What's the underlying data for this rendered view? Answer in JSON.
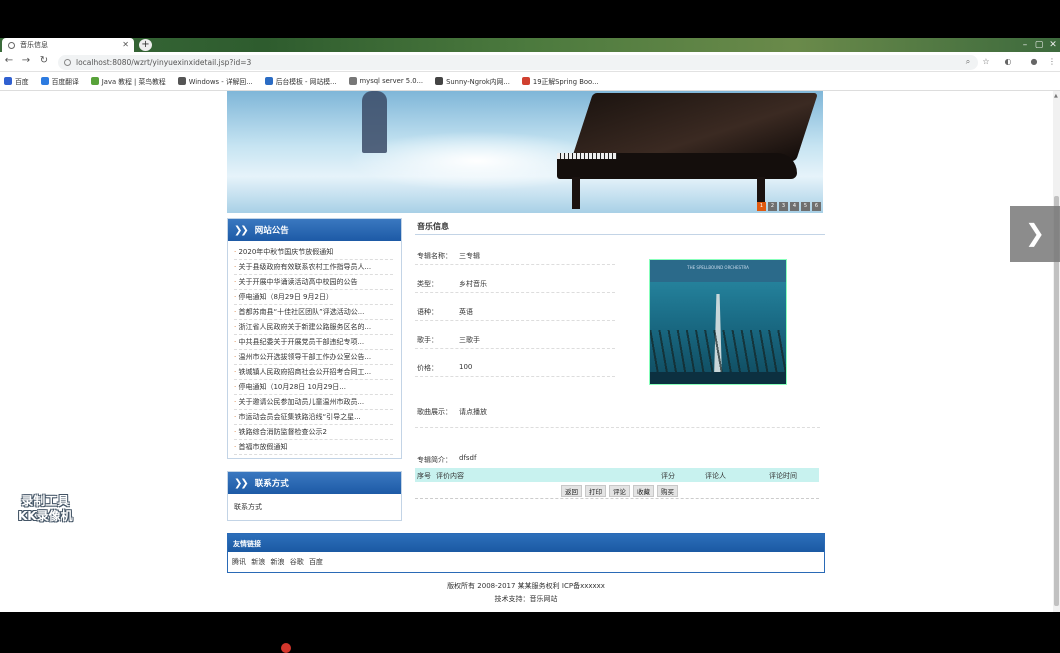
{
  "browser": {
    "tab_title": "音乐信息",
    "url": "localhost:8080/wzrt/yinyuexinxidetail.jsp?id=3",
    "bookmarks": [
      {
        "label": "百度",
        "color": "#3060d0"
      },
      {
        "label": "百度翻译",
        "color": "#2d7be0"
      },
      {
        "label": "Java 教程 | 菜鸟教程",
        "color": "#58a23a"
      },
      {
        "label": "Windows - 详解回...",
        "color": "#555555"
      },
      {
        "label": "后台模板 - 网站模...",
        "color": "#2b6cc4"
      },
      {
        "label": "mysql server 5.0...",
        "color": "#777777"
      },
      {
        "label": "Sunny-Ngrok内网...",
        "color": "#444444"
      },
      {
        "label": "19正解Spring Boo...",
        "color": "#d04030"
      }
    ]
  },
  "banner": {
    "pager": [
      "1",
      "2",
      "3",
      "4",
      "5",
      "6"
    ],
    "active_index": 0
  },
  "notices": {
    "title": "网站公告",
    "items": [
      "2020年中秋节国庆节放假通知",
      "关于县级政府有效联系农村工作指导员人...",
      "关于开展中华诵读活动高中校园的公告",
      "停电通知（8月29日 9月2日）",
      "首都苏南县“十佳社区团队”评选活动公...",
      "浙江省人民政府关于新建公路服务区名的...",
      "中共县纪委关于开展党员干部违纪专项...",
      "温州市公开选拔领导干部工作办公室公告...",
      "铁城镇人民政府招商社会公开招考合同工...",
      "停电通知（10月28日 10月29日...",
      "关于邀请公民参加动员儿童温州市政员...",
      "市运动会员会征集铁路沿线“引导之星...",
      "铁路综合消防监督检查公示2",
      "首福市放假通知"
    ]
  },
  "contact": {
    "title": "联系方式",
    "text": "联系方式"
  },
  "music": {
    "title": "音乐信息",
    "fields": [
      {
        "label": "专辑名称：",
        "value": "三专辑"
      },
      {
        "label": "类型：",
        "value": "乡村音乐"
      },
      {
        "label": "语种：",
        "value": "英语"
      },
      {
        "label": "歌手：",
        "value": "三歌手"
      },
      {
        "label": "价格：",
        "value": "100"
      }
    ],
    "preview_label": "歌曲展示：",
    "preview_value": "请点播放",
    "intro_label": "专辑简介：",
    "intro_value": "dfsdf",
    "cover_text": "THE SPELLBOUND ORCHESTRA"
  },
  "comments": {
    "columns": [
      "序号",
      "评价内容",
      "评分",
      "评论人",
      "评论时间"
    ],
    "buttons": [
      "返回",
      "打印",
      "评论",
      "收藏",
      "购买"
    ]
  },
  "links": {
    "title": "友情链接",
    "items": [
      "腾讯",
      "新浪",
      "新浪",
      "谷歌",
      "百度"
    ]
  },
  "footer": {
    "copyright": "版权所有 2008-2017 某某服务权利 ICP备xxxxxx",
    "support": "技术支持：音乐网站"
  },
  "watermark": {
    "line1": "录制工具",
    "line2": "KK录像机"
  },
  "colors": {
    "header_blue": "#1d5aa6",
    "table_head": "#c8f2ef",
    "accent_orange": "#e05a10"
  }
}
